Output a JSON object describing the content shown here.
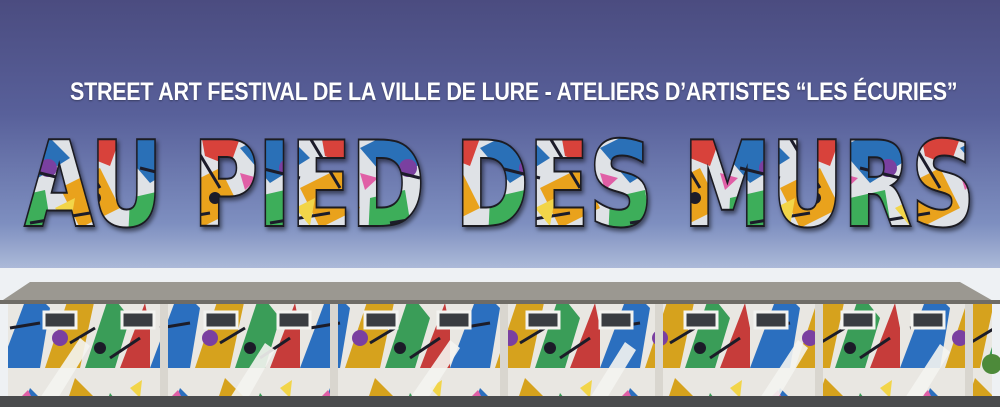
{
  "banner": {
    "subtitle": "STREET ART FESTIVAL DE LA VILLE DE LURE - ATELIERS D’ARTISTES “LES ÉCURIES”",
    "title": "AU PIED DES MURS",
    "icon": "graffiti-mural-building"
  }
}
